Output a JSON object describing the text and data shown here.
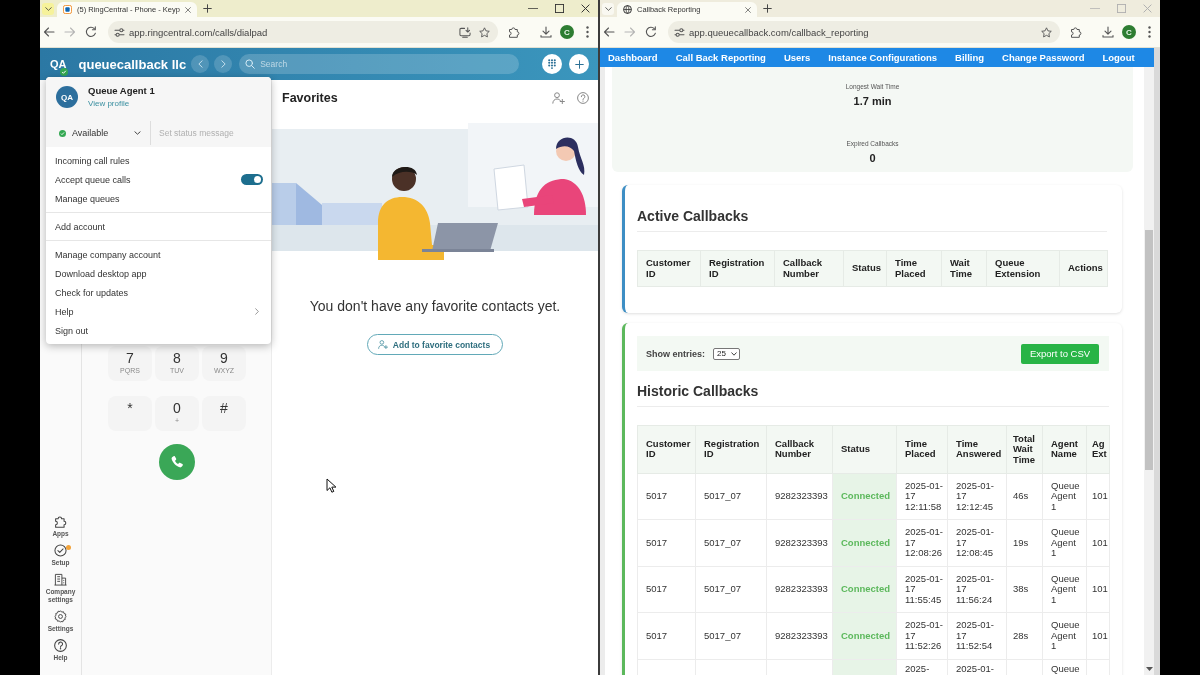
{
  "phone_window": {
    "active": true,
    "tab_title": "(5) RingCentral - Phone - Keyp",
    "address": "app.ringcentral.com/calls/dialpad",
    "profile_initial": "C",
    "app": {
      "user_initials": "QA",
      "company": "queuecallback llc",
      "search": {
        "placeholder": "Search"
      },
      "account_menu": {
        "initials": "QA",
        "name": "Queue Agent 1",
        "profile_link": "View profile",
        "status": "Available",
        "status_placeholder": "Set status message",
        "groups": [
          {
            "items": [
              {
                "label": "Incoming call rules",
                "kind": "item"
              },
              {
                "label": "Accept queue calls",
                "kind": "toggle",
                "on": true
              },
              {
                "label": "Manage queues",
                "kind": "item"
              }
            ]
          },
          {
            "items": [
              {
                "label": "Add account",
                "kind": "item"
              }
            ]
          },
          {
            "items": [
              {
                "label": "Manage company account",
                "kind": "item"
              },
              {
                "label": "Download desktop app",
                "kind": "item"
              },
              {
                "label": "Check for updates",
                "kind": "item"
              },
              {
                "label": "Help",
                "kind": "submenu"
              },
              {
                "label": "Sign out",
                "kind": "item"
              }
            ]
          }
        ]
      },
      "favorites": {
        "title": "Favorites",
        "empty_message": "You don't have any favorite contacts yet.",
        "add_button": "Add to favorite contacts"
      },
      "dialpad": {
        "keys": [
          {
            "digit": "7",
            "letters": "PQRS"
          },
          {
            "digit": "8",
            "letters": "TUV"
          },
          {
            "digit": "9",
            "letters": "WXYZ"
          },
          {
            "digit": "*"
          },
          {
            "digit": "0",
            "letters": "+"
          },
          {
            "digit": "#"
          }
        ]
      },
      "sidebar": {
        "items": [
          {
            "label": "Apps",
            "notification": false
          },
          {
            "label": "Setup",
            "notification": true
          },
          {
            "label": "Company settings",
            "notification": false
          },
          {
            "label": "Settings",
            "notification": false
          },
          {
            "label": "Help",
            "notification": false
          }
        ]
      }
    }
  },
  "reporting_window": {
    "active": false,
    "tab_title": "Callback Reporting",
    "address": "app.queuecallback.com/callback_reporting",
    "profile_initial": "C",
    "nav": [
      "Dashboard",
      "Call Back Reporting",
      "Users",
      "Instance Configurations",
      "Billing",
      "Change Password",
      "Logout"
    ],
    "stats": [
      {
        "label": "Longest Wait Time",
        "value": "1.7 min"
      },
      {
        "label": "Expired Callbacks",
        "value": "0"
      }
    ],
    "active_callbacks": {
      "title": "Active Callbacks",
      "columns": [
        "Customer ID",
        "Registration ID",
        "Callback Number",
        "Status",
        "Time Placed",
        "Wait Time",
        "Queue Extension",
        "Actions"
      ]
    },
    "historic_callbacks": {
      "show_entries_label": "Show entries:",
      "entries": "25",
      "export_button": "Export to CSV",
      "title": "Historic Callbacks",
      "columns": [
        {
          "label": "Customer ID",
          "kind": "text"
        },
        {
          "label": "Registration ID",
          "kind": "text"
        },
        {
          "label": "Callback Number",
          "kind": "text"
        },
        {
          "label": "Status",
          "kind": "status"
        },
        {
          "label": "Time Placed",
          "kind": "text"
        },
        {
          "label": "Time Answered",
          "kind": "text"
        },
        {
          "label": "Total Wait Time",
          "kind": "text"
        },
        {
          "label": "Agent Name",
          "kind": "text"
        },
        {
          "label": "Ag Ext",
          "kind": "text"
        }
      ],
      "rows": [
        [
          "5017",
          "5017_07",
          "9282323393",
          "Connected",
          "2025-01-17 12:11:58",
          "2025-01-17 12:12:45",
          "46s",
          "Queue Agent 1",
          "101"
        ],
        [
          "5017",
          "5017_07",
          "9282323393",
          "Connected",
          "2025-01-17 12:08:26",
          "2025-01-17 12:08:45",
          "19s",
          "Queue Agent 1",
          "101"
        ],
        [
          "5017",
          "5017_07",
          "9282323393",
          "Connected",
          "2025-01-17 11:55:45",
          "2025-01-17 11:56:24",
          "38s",
          "Queue Agent 1",
          "101"
        ],
        [
          "5017",
          "5017_07",
          "9282323393",
          "Connected",
          "2025-01-17 11:52:26",
          "2025-01-17 11:52:54",
          "28s",
          "Queue Agent 1",
          "101"
        ],
        [
          null,
          null,
          null,
          null,
          "2025-",
          "2025-01-",
          null,
          "Queue",
          null
        ]
      ]
    }
  }
}
